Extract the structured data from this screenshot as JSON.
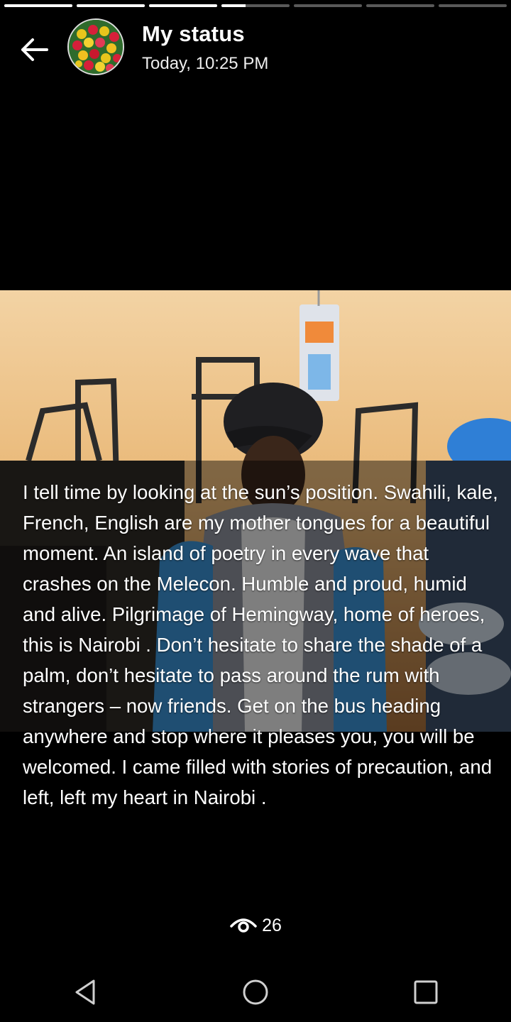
{
  "status": {
    "title": "My status",
    "time": "Today, 10:25 PM",
    "progress": [
      1,
      1,
      1,
      0.35,
      0,
      0,
      0
    ],
    "caption": "I tell time by looking at the sun’s position. Swahili, kale, French, English are my mother tongues for a beautiful moment. An island of poetry in every wave that crashes on the Melecon. Humble and proud, humid and alive. Pilgrimage of Hemingway, home of heroes, this is Nairobi . Don’t hesitate to share the shade of a palm, don’t hesitate to pass around the rum with strangers – now friends. Get on the bus heading anywhere and stop where it pleases you, you will be welcomed. I came filled with stories of precaution, and left, left my heart in Nairobi .",
    "views": "26"
  },
  "icons": {
    "back": "arrow-left-icon",
    "views": "eye-icon",
    "nav_back": "triangle-back-icon",
    "nav_home": "circle-home-icon",
    "nav_recents": "square-recents-icon"
  }
}
